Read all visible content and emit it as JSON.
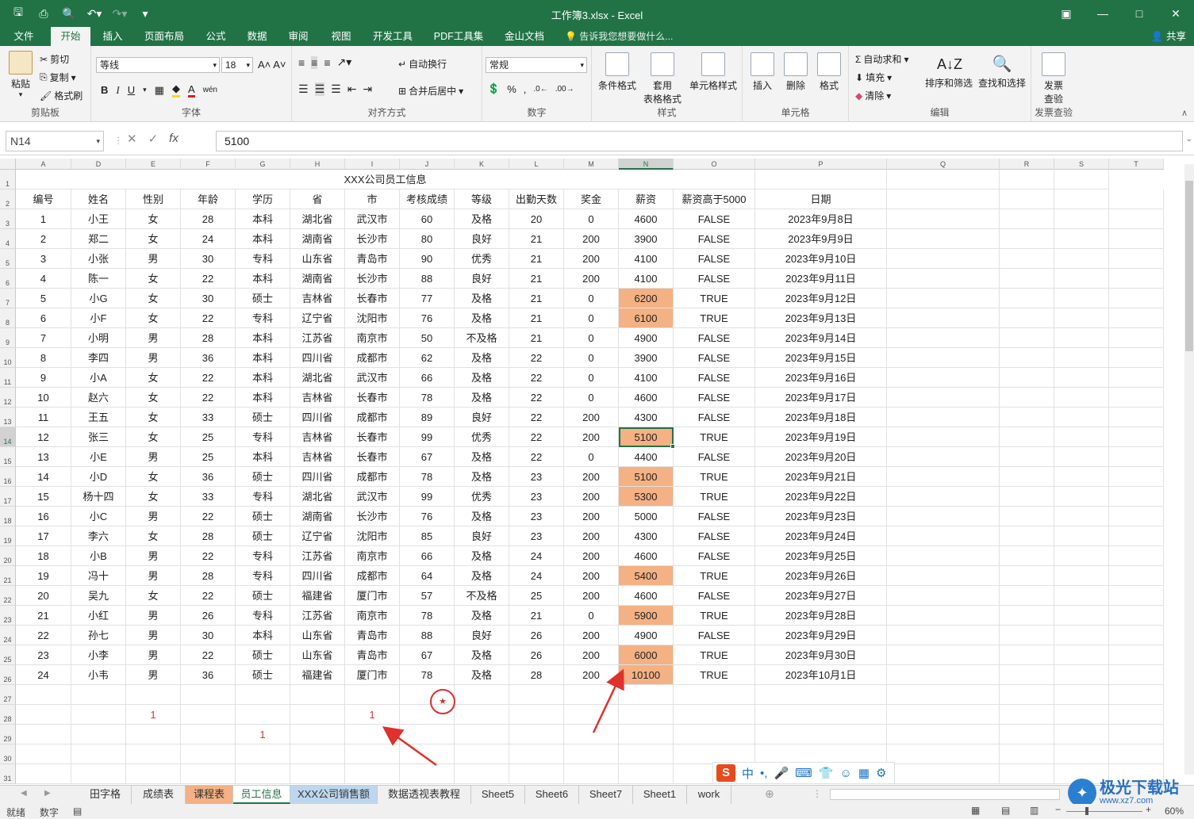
{
  "window": {
    "title": "工作簿3.xlsx - Excel"
  },
  "ribbon_tabs": [
    "文件",
    "开始",
    "插入",
    "页面布局",
    "公式",
    "数据",
    "审阅",
    "视图",
    "开发工具",
    "PDF工具集",
    "金山文档"
  ],
  "tell_me": "告诉我您想要做什么...",
  "share": "共享",
  "ribbon": {
    "clipboard": {
      "paste": "粘贴",
      "cut": "剪切",
      "copy": "复制",
      "format_painter": "格式刷",
      "label": "剪贴板"
    },
    "font": {
      "name": "等线",
      "size": "18",
      "label": "字体"
    },
    "alignment": {
      "wrap": "自动换行",
      "merge": "合并后居中",
      "label": "对齐方式"
    },
    "number": {
      "format": "常规",
      "label": "数字"
    },
    "styles": {
      "conditional": "条件格式",
      "table_a": "套用",
      "table_b": "表格格式",
      "cell_styles": "单元格样式",
      "label": "样式"
    },
    "cells": {
      "insert": "插入",
      "delete": "删除",
      "format": "格式",
      "label": "单元格"
    },
    "editing": {
      "autosum": "自动求和",
      "fill": "填充",
      "clear": "清除",
      "sort": "排序和筛选",
      "find": "查找和选择",
      "label": "编辑"
    },
    "invoice": {
      "a": "发票",
      "b": "查验",
      "label": "发票查验"
    }
  },
  "formula_bar": {
    "name_box": "N14",
    "value": "5100"
  },
  "columns": [
    "A",
    "D",
    "E",
    "F",
    "G",
    "H",
    "I",
    "J",
    "K",
    "L",
    "M",
    "N",
    "O",
    "P",
    "Q",
    "R",
    "S",
    "T"
  ],
  "sheet_title": "XXX公司员工信息",
  "headers": [
    "编号",
    "姓名",
    "性别",
    "年龄",
    "学历",
    "省",
    "市",
    "考核成绩",
    "等级",
    "出勤天数",
    "奖金",
    "薪资",
    "薪资高于5000",
    "日期"
  ],
  "rows": [
    [
      "1",
      "小王",
      "女",
      "28",
      "本科",
      "湖北省",
      "武汉市",
      "60",
      "及格",
      "20",
      "0",
      "4600",
      "FALSE",
      "2023年9月8日"
    ],
    [
      "2",
      "郑二",
      "女",
      "24",
      "本科",
      "湖南省",
      "长沙市",
      "80",
      "良好",
      "21",
      "200",
      "3900",
      "FALSE",
      "2023年9月9日"
    ],
    [
      "3",
      "小张",
      "男",
      "30",
      "专科",
      "山东省",
      "青岛市",
      "90",
      "优秀",
      "21",
      "200",
      "4100",
      "FALSE",
      "2023年9月10日"
    ],
    [
      "4",
      "陈一",
      "女",
      "22",
      "本科",
      "湖南省",
      "长沙市",
      "88",
      "良好",
      "21",
      "200",
      "4100",
      "FALSE",
      "2023年9月11日"
    ],
    [
      "5",
      "小G",
      "女",
      "30",
      "硕士",
      "吉林省",
      "长春市",
      "77",
      "及格",
      "21",
      "0",
      "6200",
      "TRUE",
      "2023年9月12日"
    ],
    [
      "6",
      "小F",
      "女",
      "22",
      "专科",
      "辽宁省",
      "沈阳市",
      "76",
      "及格",
      "21",
      "0",
      "6100",
      "TRUE",
      "2023年9月13日"
    ],
    [
      "7",
      "小明",
      "男",
      "28",
      "本科",
      "江苏省",
      "南京市",
      "50",
      "不及格",
      "21",
      "0",
      "4900",
      "FALSE",
      "2023年9月14日"
    ],
    [
      "8",
      "李四",
      "男",
      "36",
      "本科",
      "四川省",
      "成都市",
      "62",
      "及格",
      "22",
      "0",
      "3900",
      "FALSE",
      "2023年9月15日"
    ],
    [
      "9",
      "小A",
      "女",
      "22",
      "本科",
      "湖北省",
      "武汉市",
      "66",
      "及格",
      "22",
      "0",
      "4100",
      "FALSE",
      "2023年9月16日"
    ],
    [
      "10",
      "赵六",
      "女",
      "22",
      "本科",
      "吉林省",
      "长春市",
      "78",
      "及格",
      "22",
      "0",
      "4600",
      "FALSE",
      "2023年9月17日"
    ],
    [
      "11",
      "王五",
      "女",
      "33",
      "硕士",
      "四川省",
      "成都市",
      "89",
      "良好",
      "22",
      "200",
      "4300",
      "FALSE",
      "2023年9月18日"
    ],
    [
      "12",
      "张三",
      "女",
      "25",
      "专科",
      "吉林省",
      "长春市",
      "99",
      "优秀",
      "22",
      "200",
      "5100",
      "TRUE",
      "2023年9月19日"
    ],
    [
      "13",
      "小E",
      "男",
      "25",
      "本科",
      "吉林省",
      "长春市",
      "67",
      "及格",
      "22",
      "0",
      "4400",
      "FALSE",
      "2023年9月20日"
    ],
    [
      "14",
      "小D",
      "女",
      "36",
      "硕士",
      "四川省",
      "成都市",
      "78",
      "及格",
      "23",
      "200",
      "5100",
      "TRUE",
      "2023年9月21日"
    ],
    [
      "15",
      "杨十四",
      "女",
      "33",
      "专科",
      "湖北省",
      "武汉市",
      "99",
      "优秀",
      "23",
      "200",
      "5300",
      "TRUE",
      "2023年9月22日"
    ],
    [
      "16",
      "小C",
      "男",
      "22",
      "硕士",
      "湖南省",
      "长沙市",
      "76",
      "及格",
      "23",
      "200",
      "5000",
      "FALSE",
      "2023年9月23日"
    ],
    [
      "17",
      "李六",
      "女",
      "28",
      "硕士",
      "辽宁省",
      "沈阳市",
      "85",
      "良好",
      "23",
      "200",
      "4300",
      "FALSE",
      "2023年9月24日"
    ],
    [
      "18",
      "小B",
      "男",
      "22",
      "专科",
      "江苏省",
      "南京市",
      "66",
      "及格",
      "24",
      "200",
      "4600",
      "FALSE",
      "2023年9月25日"
    ],
    [
      "19",
      "冯十",
      "男",
      "28",
      "专科",
      "四川省",
      "成都市",
      "64",
      "及格",
      "24",
      "200",
      "5400",
      "TRUE",
      "2023年9月26日"
    ],
    [
      "20",
      "吴九",
      "女",
      "22",
      "硕士",
      "福建省",
      "厦门市",
      "57",
      "不及格",
      "25",
      "200",
      "4600",
      "FALSE",
      "2023年9月27日"
    ],
    [
      "21",
      "小红",
      "男",
      "26",
      "专科",
      "江苏省",
      "南京市",
      "78",
      "及格",
      "21",
      "0",
      "5900",
      "TRUE",
      "2023年9月28日"
    ],
    [
      "22",
      "孙七",
      "男",
      "30",
      "本科",
      "山东省",
      "青岛市",
      "88",
      "良好",
      "26",
      "200",
      "4900",
      "FALSE",
      "2023年9月29日"
    ],
    [
      "23",
      "小李",
      "男",
      "22",
      "硕士",
      "山东省",
      "青岛市",
      "67",
      "及格",
      "26",
      "200",
      "6000",
      "TRUE",
      "2023年9月30日"
    ],
    [
      "24",
      "小韦",
      "男",
      "36",
      "硕士",
      "福建省",
      "厦门市",
      "78",
      "及格",
      "28",
      "200",
      "10100",
      "TRUE",
      "2023年10月1日"
    ]
  ],
  "extra_cells": {
    "e28": "1",
    "i28": "1",
    "g29": "1"
  },
  "sheet_tabs": [
    "田字格",
    "成绩表",
    "课程表",
    "员工信息",
    "XXX公司销售额",
    "数据透视表教程",
    "Sheet5",
    "Sheet6",
    "Sheet7",
    "Sheet1",
    "work"
  ],
  "status": {
    "ready": "就绪",
    "num": "数字",
    "zoom": "60%"
  },
  "watermark": {
    "name": "极光下载站",
    "site": "www.xz7.com"
  },
  "colors": {
    "ribbon": "#217346",
    "highlight": "#f4b183",
    "arrow": "#e0312c"
  }
}
